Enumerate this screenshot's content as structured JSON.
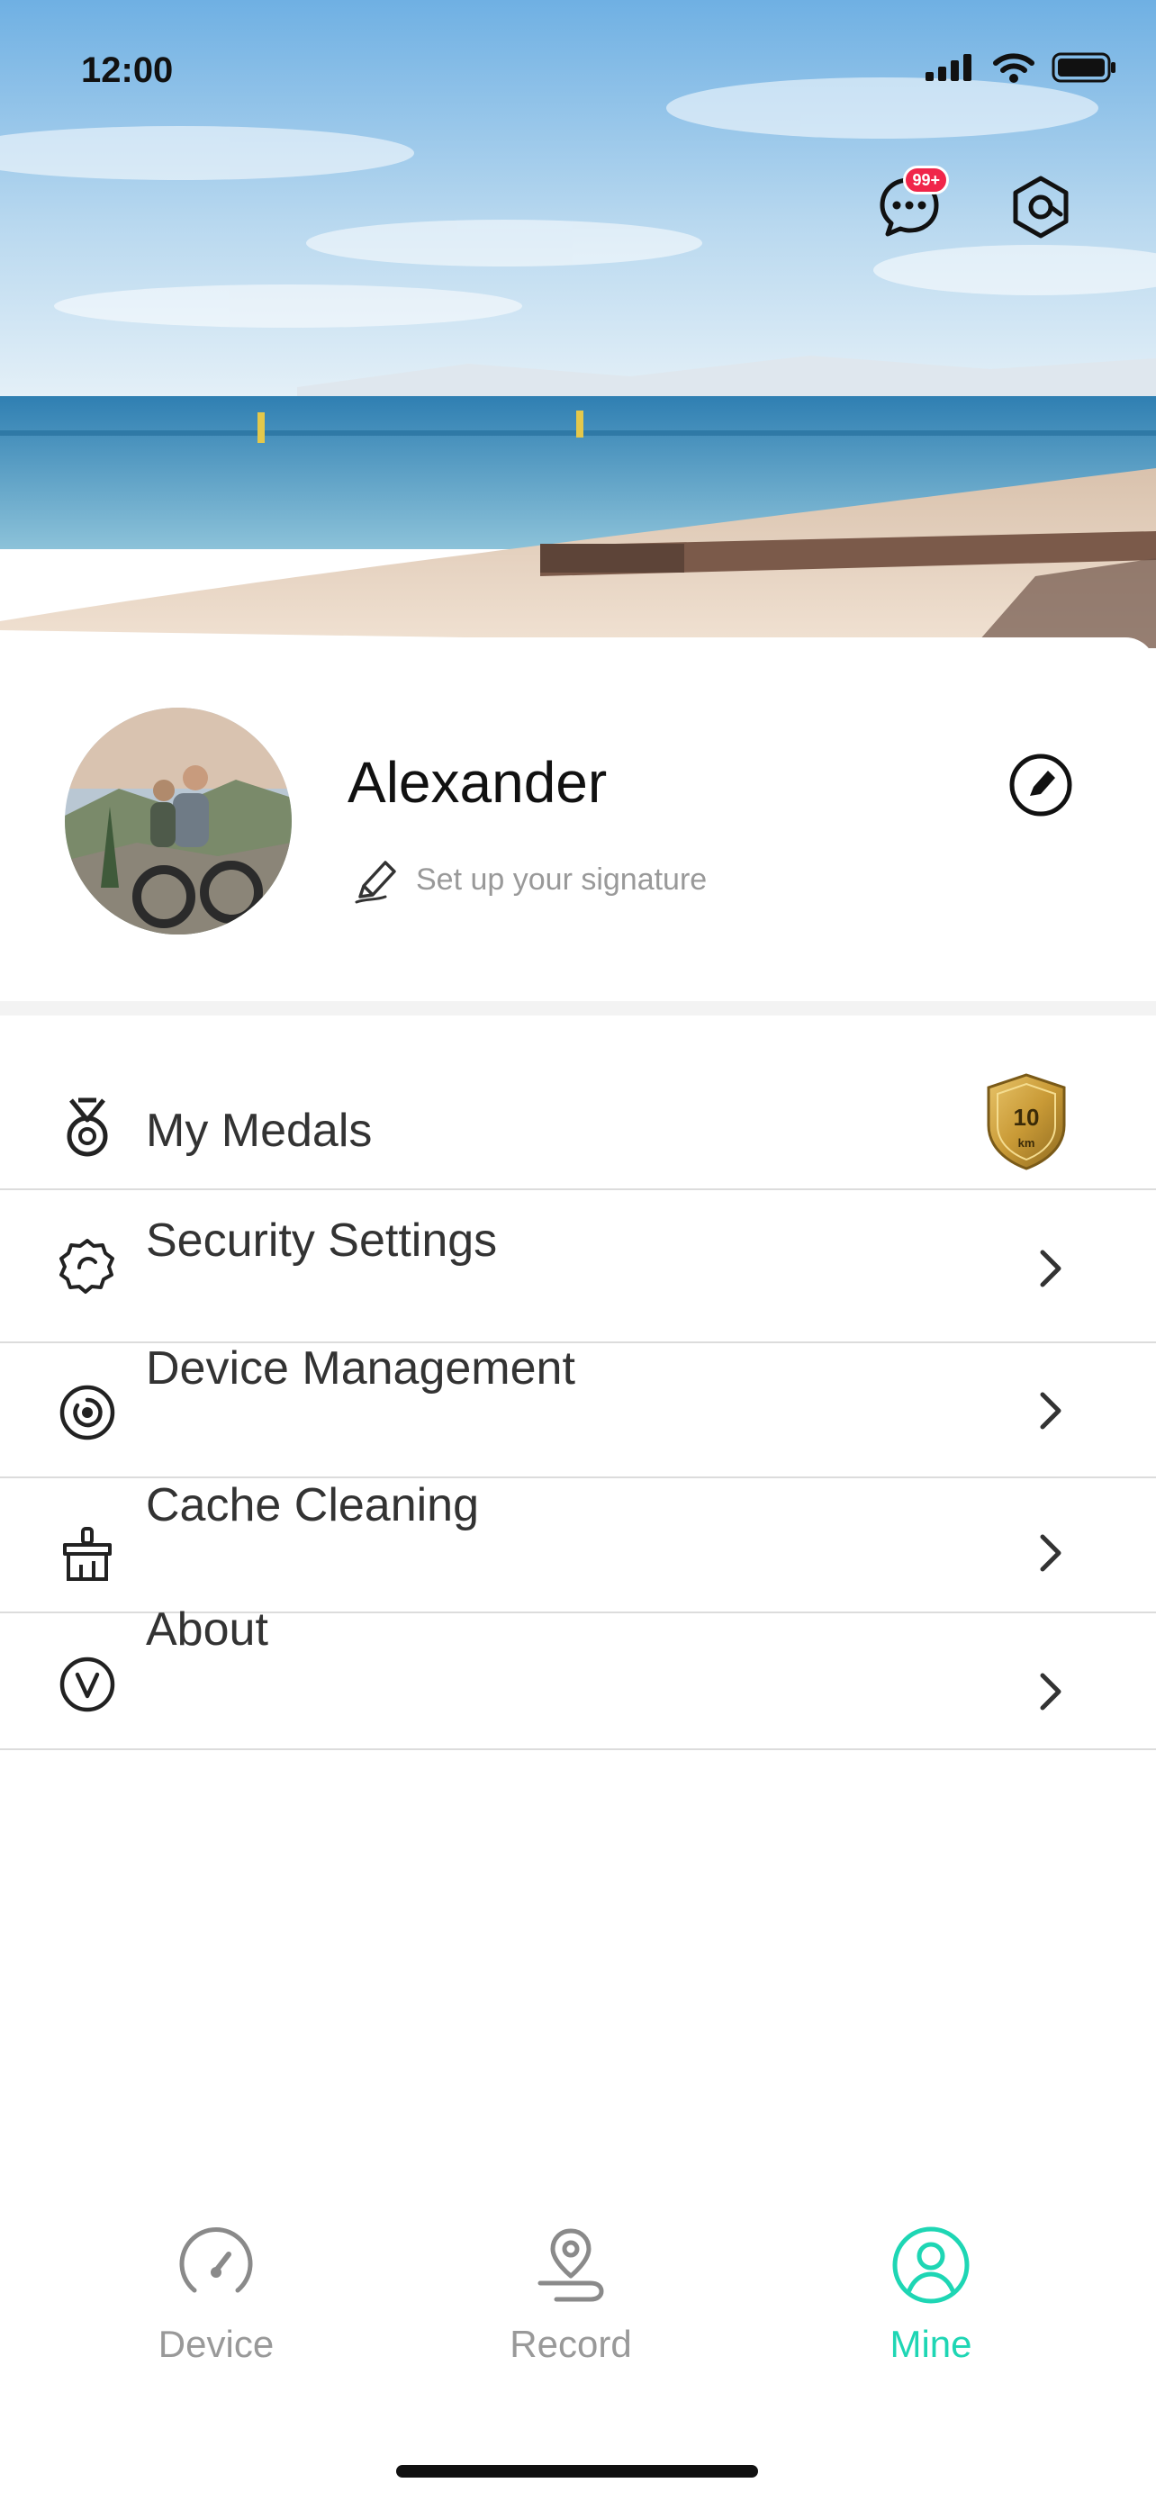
{
  "status_bar": {
    "time": "12:00"
  },
  "header": {
    "messages_badge": "99+",
    "icons": [
      "message-icon",
      "settings-hex-icon"
    ]
  },
  "profile": {
    "name": "Alexander",
    "signature_placeholder": "Set up your signature"
  },
  "menu": {
    "medals": {
      "label": "My Medals",
      "medal_number": "10",
      "medal_unit": "km"
    },
    "security": {
      "label": "Security Settings"
    },
    "device_mgmt": {
      "label": "Device Management"
    },
    "cache": {
      "label": "Cache Cleaning"
    },
    "about": {
      "label": "About"
    }
  },
  "tabbar": {
    "device": "Device",
    "record": "Record",
    "mine": "Mine",
    "active": "Mine"
  },
  "colors": {
    "accent": "#1ed6b4",
    "badge": "#f0254a",
    "sky": "#7fb8e6",
    "sea": "#3f8fc0",
    "sand": "#e9d6c4"
  }
}
